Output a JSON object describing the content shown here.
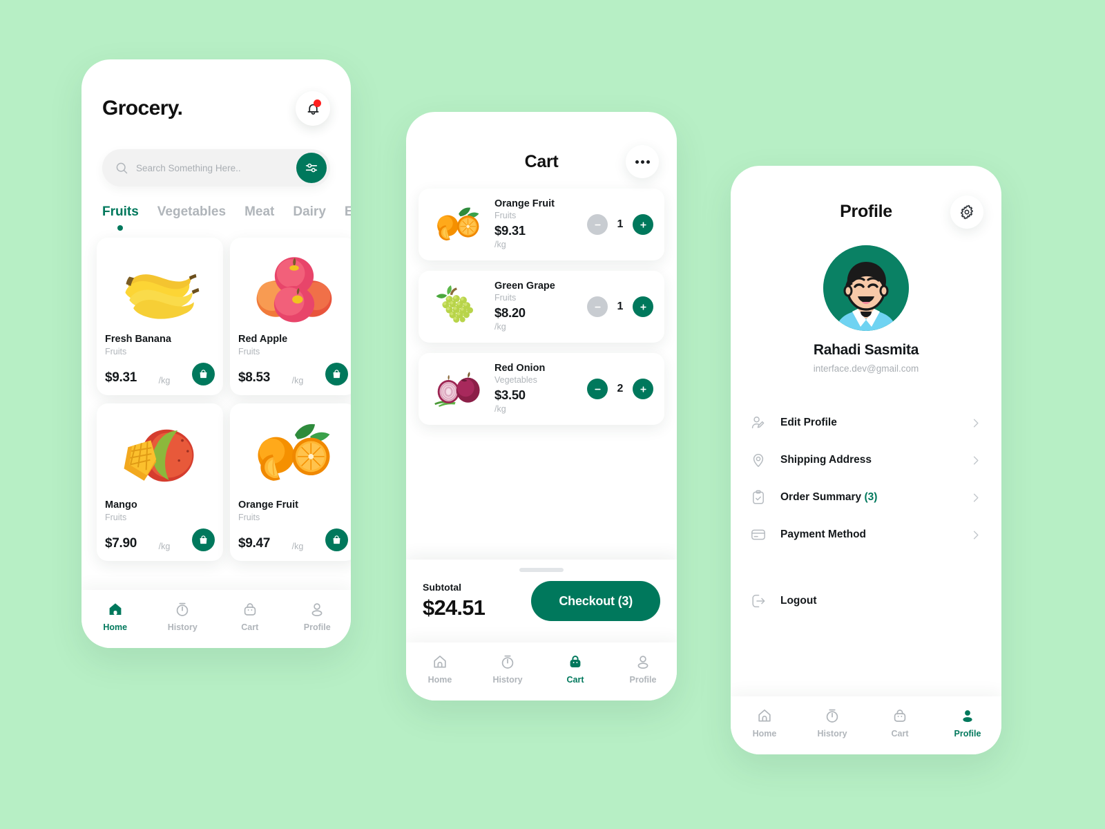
{
  "theme": {
    "background": "#b7efc5",
    "accent": "#00785c",
    "muted": "#b0b5ba",
    "text": "#14181b",
    "badge": "#ff1f1f"
  },
  "home": {
    "brand": "Grocery.",
    "bell_icon": "bell-icon",
    "search": {
      "placeholder": "Search Something Here..",
      "value": "",
      "search_icon": "search-icon",
      "filter_icon": "sliders-icon"
    },
    "tabs": [
      {
        "label": "Fruits",
        "active": true
      },
      {
        "label": "Vegetables",
        "active": false
      },
      {
        "label": "Meat",
        "active": false
      },
      {
        "label": "Dairy",
        "active": false
      },
      {
        "label": "Eggs",
        "active": false
      }
    ],
    "products": [
      {
        "name": "Fresh Banana",
        "category": "Fruits",
        "price": "$9.31",
        "unit": "/kg",
        "image": "banana-image",
        "action_icon": "bag-icon"
      },
      {
        "name": "Red Apple",
        "category": "Fruits",
        "price": "$8.53",
        "unit": "/kg",
        "image": "apple-image",
        "action_icon": "bag-icon"
      },
      {
        "name": "Mango",
        "category": "Fruits",
        "price": "$7.90",
        "unit": "/kg",
        "image": "mango-image",
        "action_icon": "bag-icon"
      },
      {
        "name": "Orange Fruit",
        "category": "Fruits",
        "price": "$9.47",
        "unit": "/kg",
        "image": "orange-image",
        "action_icon": "bag-icon"
      }
    ],
    "bottom_nav": [
      {
        "label": "Home",
        "icon": "home-icon",
        "active": true
      },
      {
        "label": "History",
        "icon": "stopwatch-icon",
        "active": false
      },
      {
        "label": "Cart",
        "icon": "bag-icon",
        "active": false
      },
      {
        "label": "Profile",
        "icon": "person-icon",
        "active": false
      }
    ]
  },
  "cart": {
    "title": "Cart",
    "more_icon": "more-horizontal-icon",
    "items": [
      {
        "name": "Orange Fruit",
        "category": "Fruits",
        "price": "$9.31",
        "unit": "/kg",
        "qty": "1",
        "minus_enabled": false,
        "image": "orange-image"
      },
      {
        "name": "Green Grape",
        "category": "Fruits",
        "price": "$8.20",
        "unit": "/kg",
        "qty": "1",
        "minus_enabled": false,
        "image": "grape-image"
      },
      {
        "name": "Red Onion",
        "category": "Vegetables",
        "price": "$3.50",
        "unit": "/kg",
        "qty": "2",
        "minus_enabled": true,
        "image": "onion-image"
      }
    ],
    "footer": {
      "subtotal_label": "Subtotal",
      "subtotal_amount": "$24.51",
      "checkout_label": "Checkout (3)"
    },
    "bottom_nav": [
      {
        "label": "Home",
        "icon": "home-icon",
        "active": false
      },
      {
        "label": "History",
        "icon": "stopwatch-icon",
        "active": false
      },
      {
        "label": "Cart",
        "icon": "bag-icon",
        "active": true
      },
      {
        "label": "Profile",
        "icon": "person-icon",
        "active": false
      }
    ]
  },
  "profile": {
    "title": "Profile",
    "settings_icon": "gear-icon",
    "user": {
      "avatar": "avatar-illustration",
      "name": "Rahadi Sasmita",
      "email": "interface.dev@gmail.com"
    },
    "menu": [
      {
        "label": "Edit Profile",
        "count": "",
        "icon": "user-edit-icon",
        "chevron": true
      },
      {
        "label": "Shipping Address",
        "count": "",
        "icon": "location-pin-icon",
        "chevron": true
      },
      {
        "label": "Order Summary",
        "count": "(3)",
        "icon": "clipboard-check-icon",
        "chevron": true
      },
      {
        "label": "Payment Method",
        "count": "",
        "icon": "credit-card-icon",
        "chevron": true
      },
      {
        "label": "Logout",
        "count": "",
        "icon": "logout-icon",
        "chevron": false
      }
    ],
    "bottom_nav": [
      {
        "label": "Home",
        "icon": "home-icon",
        "active": false
      },
      {
        "label": "History",
        "icon": "stopwatch-icon",
        "active": false
      },
      {
        "label": "Cart",
        "icon": "bag-icon",
        "active": false
      },
      {
        "label": "Profile",
        "icon": "person-icon",
        "active": true
      }
    ]
  }
}
